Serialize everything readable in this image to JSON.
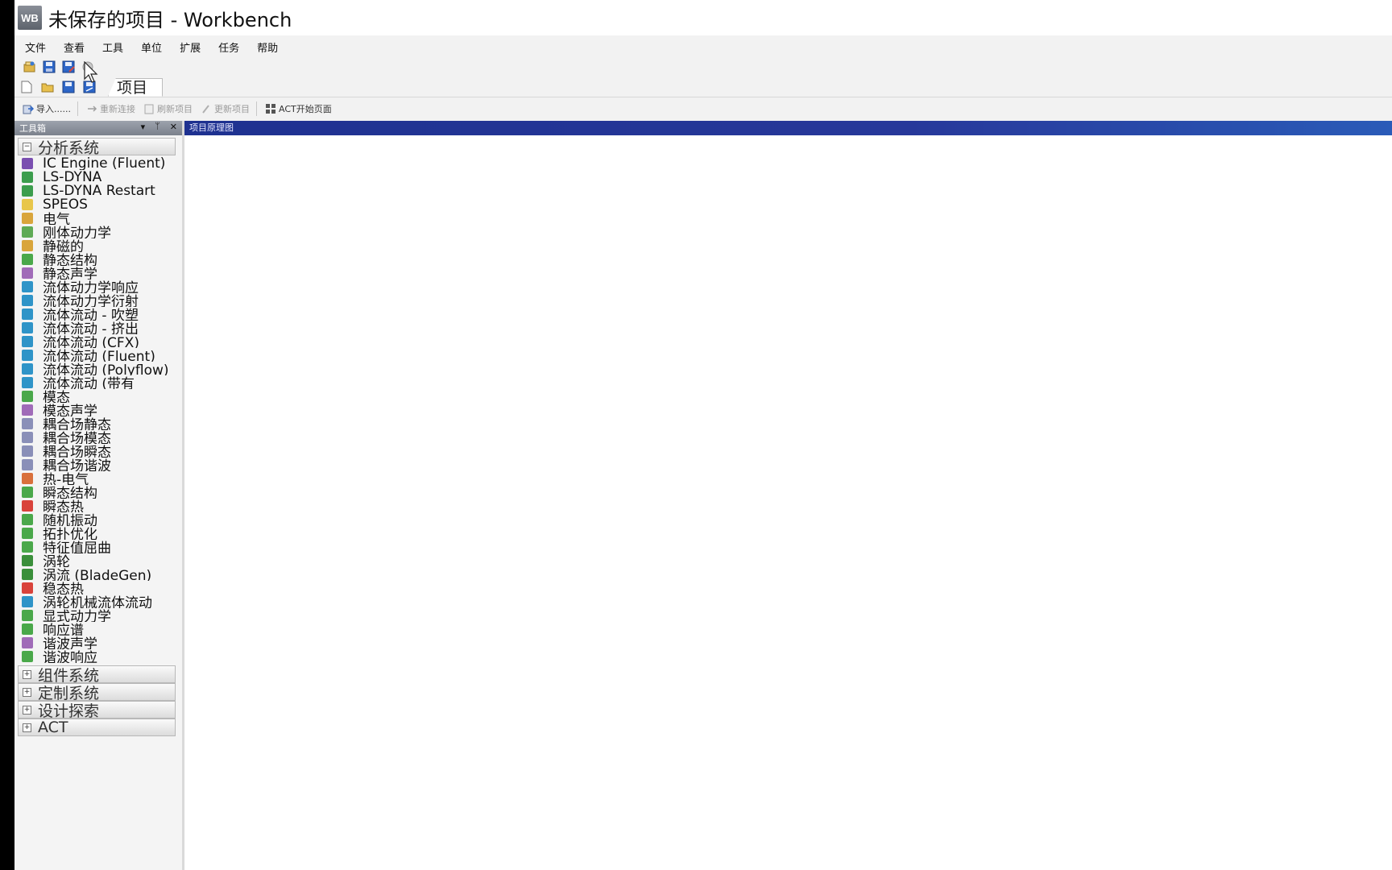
{
  "window": {
    "logo_text": "WB",
    "title": "未保存的项目 - Workbench"
  },
  "menu": [
    "文件",
    "查看",
    "工具",
    "单位",
    "扩展",
    "任务",
    "帮助"
  ],
  "toolbar1": {
    "icons": [
      "open-project-icon",
      "save-icon",
      "save-as-icon",
      "refresh-icon"
    ]
  },
  "toolbar2": {
    "icons": [
      "new-icon",
      "open-folder-icon",
      "save-icon",
      "save-as-icon"
    ],
    "tab_label": "项目"
  },
  "toolbar3": {
    "items": [
      {
        "label": "导入......",
        "icon": "import-icon",
        "enabled": true
      },
      {
        "label": "重新连接",
        "icon": "reconnect-icon",
        "enabled": false
      },
      {
        "label": "刷新项目",
        "icon": "refresh-project-icon",
        "enabled": false
      },
      {
        "label": "更新项目",
        "icon": "update-project-icon",
        "enabled": false
      },
      {
        "label": "ACT开始页面",
        "icon": "act-start-page-icon",
        "enabled": true
      }
    ]
  },
  "toolbox": {
    "header": "工具箱",
    "header_controls": [
      "▾",
      "ᛘ",
      "✕"
    ],
    "sections": [
      {
        "title": "分析系统",
        "expander": "⊟",
        "items": [
          {
            "label": "IC Engine (Fluent)",
            "color": "#7a4fb0"
          },
          {
            "label": "LS-DYNA",
            "color": "#3c9d4d"
          },
          {
            "label": "LS-DYNA Restart",
            "color": "#3c9d4d"
          },
          {
            "label": "SPEOS",
            "color": "#e8c64a"
          },
          {
            "label": "电气",
            "color": "#d9a53b"
          },
          {
            "label": "刚体动力学",
            "color": "#5faa55"
          },
          {
            "label": "静磁的",
            "color": "#d9a53b"
          },
          {
            "label": "静态结构",
            "color": "#4aa84a"
          },
          {
            "label": "静态声学",
            "color": "#a06bb8"
          },
          {
            "label": "流体动力学响应",
            "color": "#2f94c8"
          },
          {
            "label": "流体动力学衍射",
            "color": "#2f94c8"
          },
          {
            "label": "流体流动 - 吹塑",
            "color": "#2f94c8"
          },
          {
            "label": "流体流动 - 挤出",
            "color": "#2f94c8"
          },
          {
            "label": "流体流动 (CFX)",
            "color": "#2f94c8"
          },
          {
            "label": "流体流动 (Fluent)",
            "color": "#2f94c8"
          },
          {
            "label": "流体流动 (Polyflow)",
            "color": "#2f94c8"
          },
          {
            "label": "流体流动 (带有",
            "color": "#2f94c8"
          },
          {
            "label": "模态",
            "color": "#4aa84a"
          },
          {
            "label": "模态声学",
            "color": "#a06bb8"
          },
          {
            "label": "耦合场静态",
            "color": "#8a8fb8"
          },
          {
            "label": "耦合场模态",
            "color": "#8a8fb8"
          },
          {
            "label": "耦合场瞬态",
            "color": "#8a8fb8"
          },
          {
            "label": "耦合场谐波",
            "color": "#8a8fb8"
          },
          {
            "label": "热-电气",
            "color": "#d9703b"
          },
          {
            "label": "瞬态结构",
            "color": "#4aa84a"
          },
          {
            "label": "瞬态热",
            "color": "#d9433b"
          },
          {
            "label": "随机振动",
            "color": "#4aa84a"
          },
          {
            "label": "拓扑优化",
            "color": "#4aa84a"
          },
          {
            "label": "特征值屈曲",
            "color": "#4aa84a"
          },
          {
            "label": "涡轮",
            "color": "#3a8f3a"
          },
          {
            "label": "涡流 (BladeGen)",
            "color": "#3a8f3a"
          },
          {
            "label": "稳态热",
            "color": "#d9433b"
          },
          {
            "label": "涡轮机械流体流动",
            "color": "#2f94c8"
          },
          {
            "label": "显式动力学",
            "color": "#4aa84a"
          },
          {
            "label": "响应谱",
            "color": "#4aa84a"
          },
          {
            "label": "谐波声学",
            "color": "#a06bb8"
          },
          {
            "label": "谐波响应",
            "color": "#4aa84a"
          }
        ]
      },
      {
        "title": "组件系统",
        "expander": "⊞"
      },
      {
        "title": "定制系统",
        "expander": "⊞"
      },
      {
        "title": "设计探索",
        "expander": "⊞"
      },
      {
        "title": "ACT",
        "expander": "⊞"
      }
    ]
  },
  "schematic": {
    "header": "项目原理图"
  }
}
